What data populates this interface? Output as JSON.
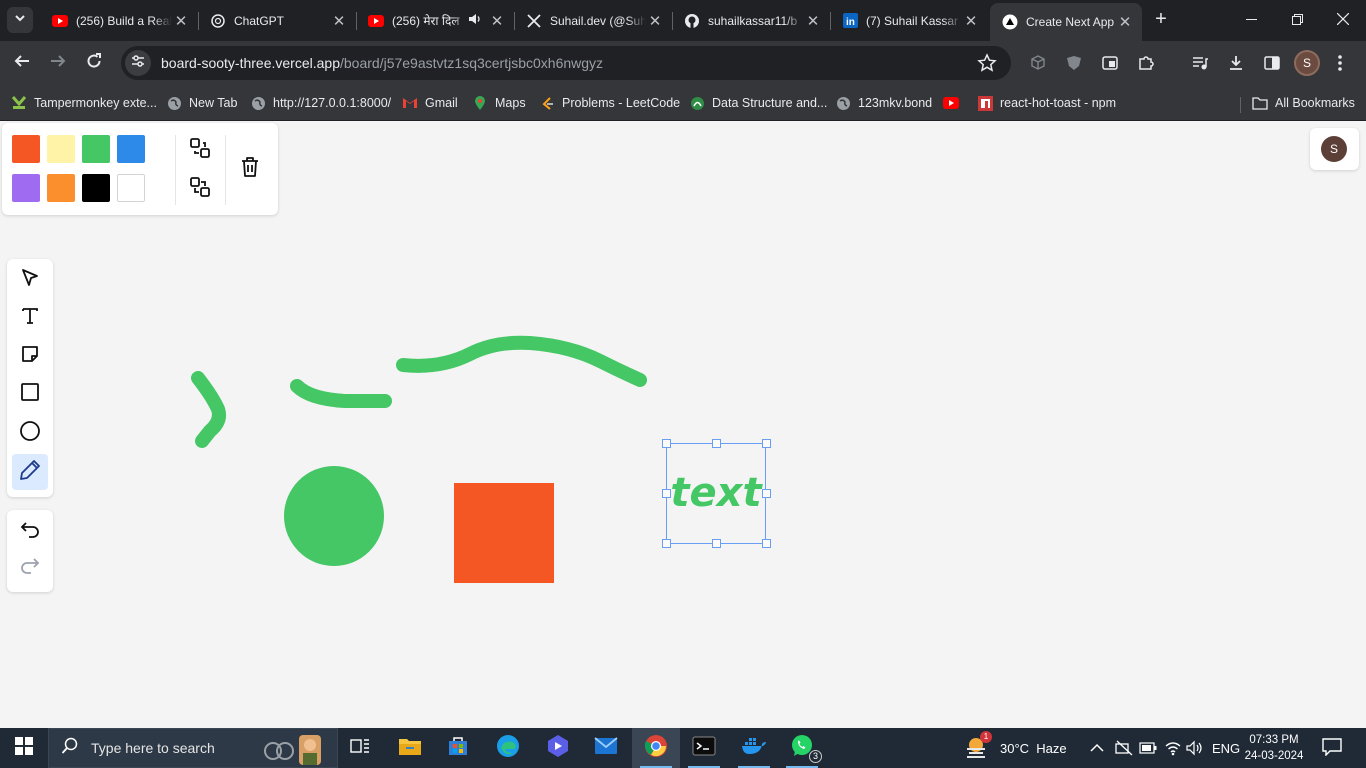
{
  "browser": {
    "tabs": [
      {
        "title": "(256) Build a Real",
        "favicon": "youtube-icon"
      },
      {
        "title": "ChatGPT",
        "favicon": "chatgpt-icon"
      },
      {
        "title": "(256) मेरा दिल",
        "favicon": "youtube-icon",
        "audio": true
      },
      {
        "title": "Suhail.dev (@Suh",
        "favicon": "x-icon"
      },
      {
        "title": "suhailkassar11/b",
        "favicon": "github-icon"
      },
      {
        "title": "(7) Suhail Kassar",
        "favicon": "linkedin-icon"
      },
      {
        "title": "Create Next App",
        "favicon": "vercel-icon",
        "active": true
      }
    ],
    "url_host": "board-sooty-three.vercel.app",
    "url_path": "/board/j57e9astvtz1sq3certjsbc0xh6nwgyz",
    "profile_initial": "S",
    "bookmarks": [
      {
        "label": "Tampermonkey exte...",
        "icon": "tampermonkey-icon"
      },
      {
        "label": "New Tab",
        "icon": "globe-icon"
      },
      {
        "label": "http://127.0.0.1:8000/",
        "icon": "globe-icon"
      },
      {
        "label": "Gmail",
        "icon": "gmail-icon"
      },
      {
        "label": "Maps",
        "icon": "maps-icon"
      },
      {
        "label": "Problems - LeetCode",
        "icon": "leetcode-icon"
      },
      {
        "label": "Data Structure and...",
        "icon": "android-icon"
      },
      {
        "label": "123mkv.bond",
        "icon": "globe-icon"
      },
      {
        "label": "",
        "icon": "youtube-icon"
      },
      {
        "label": "react-hot-toast - npm",
        "icon": "npm-icon"
      }
    ],
    "all_bookmarks_label": "All Bookmarks"
  },
  "app": {
    "colors": [
      "#f55724",
      "#fef3a6",
      "#44c764",
      "#2d8ae8",
      "#9f6bf0",
      "#fb8f2e",
      "#000000",
      "#ffffff"
    ],
    "selected_tool": "pencil",
    "user_initial": "S",
    "canvas": {
      "text_layer": {
        "text": "text",
        "color": "#44c764"
      },
      "ellipse_color": "#44c764",
      "rectangle_color": "#f55724",
      "stroke_color": "#44c764"
    }
  },
  "taskbar": {
    "search_placeholder": "Type here to search",
    "weather": "30°C  Haze",
    "weather_alert": "1",
    "language": "ENG",
    "time": "07:33 PM",
    "date": "24-03-2024",
    "whatsapp_badge": "3"
  }
}
